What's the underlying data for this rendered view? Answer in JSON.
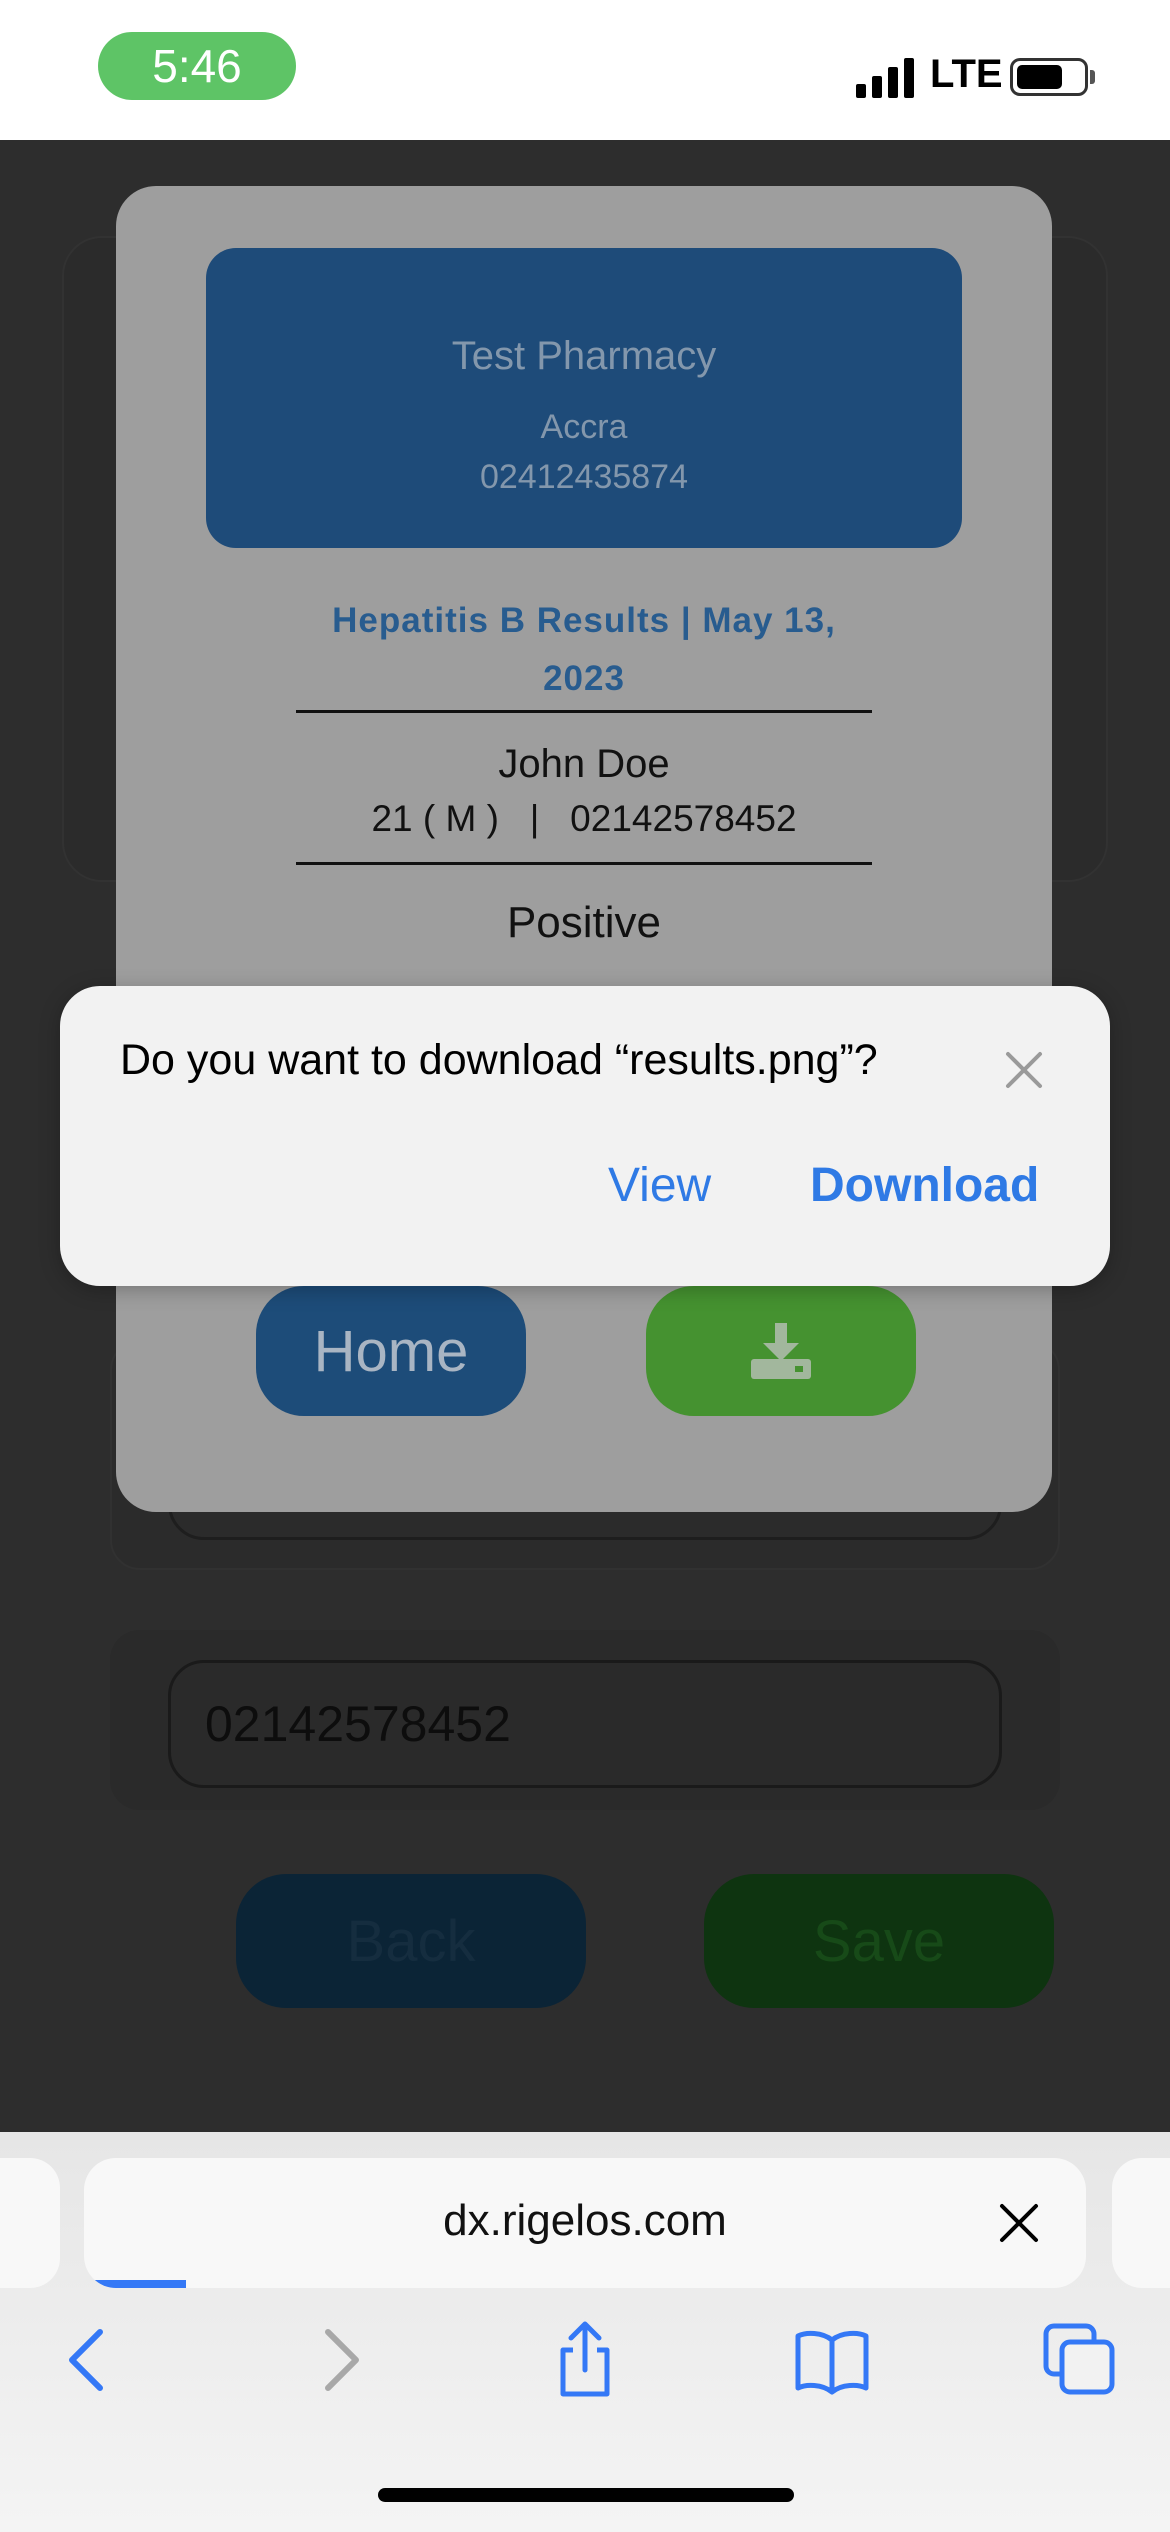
{
  "status_bar": {
    "time": "5:46",
    "network": "LTE"
  },
  "background_page": {
    "phone_value": "02142578452",
    "back_label": "Back",
    "save_label": "Save"
  },
  "result_card": {
    "pharmacy_name": "Test Pharmacy",
    "pharmacy_city": "Accra",
    "pharmacy_phone": "02412435874",
    "result_title": "Hepatitis B Results  |  May 13, 2023",
    "patient_name": "John Doe",
    "patient_info": "21 ( M )   |   02142578452",
    "result_value": "Positive",
    "home_label": "Home"
  },
  "dialog": {
    "message": "Do you want to download “results.png”?",
    "view_label": "View",
    "download_label": "Download"
  },
  "browser": {
    "url": "dx.rigelos.com"
  },
  "colors": {
    "accent": "#2f7ae5",
    "pharmacy_blue": "#1e4b79",
    "download_green": "#459230",
    "time_pill": "#5ec466"
  }
}
